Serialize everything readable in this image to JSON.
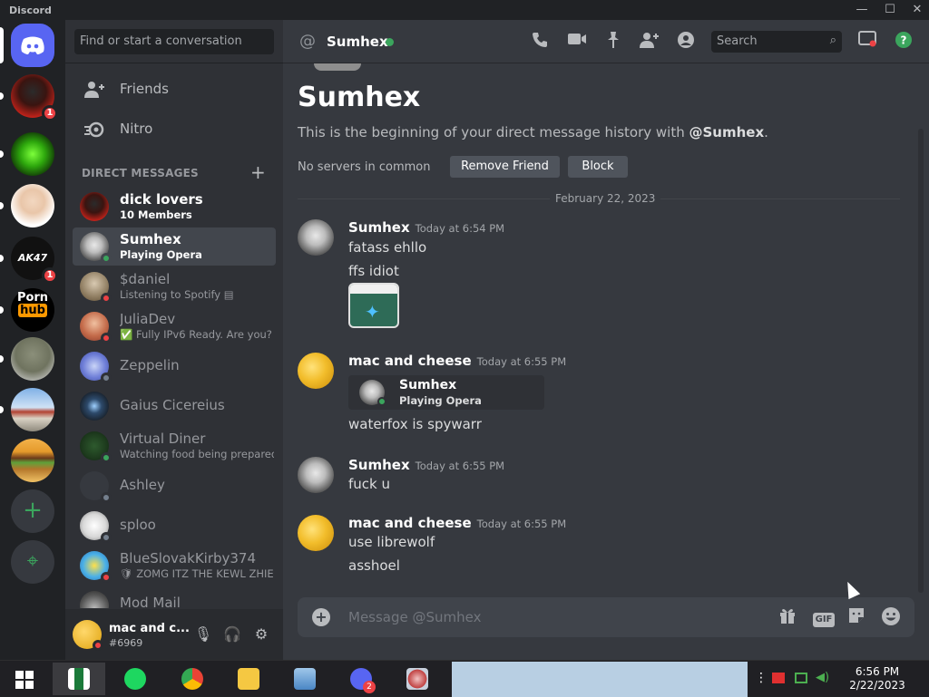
{
  "app": {
    "title": "Discord"
  },
  "window_controls": {
    "minimize": "—",
    "maximize": "☐",
    "close": "✕"
  },
  "servers": [
    {
      "name": "Home",
      "icon": "discord-logo-icon"
    },
    {
      "name": "server-2",
      "badge": "1"
    },
    {
      "name": "server-3"
    },
    {
      "name": "server-4"
    },
    {
      "name": "server-5",
      "badge": "1"
    },
    {
      "name": "server-6",
      "text": "Porn hub"
    },
    {
      "name": "server-7"
    },
    {
      "name": "server-8"
    },
    {
      "name": "server-9"
    }
  ],
  "add_server": "+",
  "explore": "⌖",
  "dm_sidebar": {
    "search_placeholder": "Find or start a conversation",
    "nav": [
      {
        "label": "Friends",
        "icon": "friends-icon"
      },
      {
        "label": "Nitro",
        "icon": "nitro-icon"
      }
    ],
    "header": "DIRECT MESSAGES",
    "add": "+",
    "dms": [
      {
        "name": "dick lovers",
        "sub": "10 Members",
        "status": "none",
        "highlight": true
      },
      {
        "name": "Sumhex",
        "sub": "Playing Opera",
        "status": "online",
        "selected": true
      },
      {
        "name": "$daniel",
        "sub": "Listening to Spotify ▤",
        "status": "dnd"
      },
      {
        "name": "JuliaDev",
        "sub": "✅ Fully IPv6 Ready. Are you?",
        "status": "dnd"
      },
      {
        "name": "Zeppelin",
        "sub": "",
        "status": "offline"
      },
      {
        "name": "Gaius Cicereius",
        "sub": "",
        "status": "offline"
      },
      {
        "name": "Virtual Diner",
        "sub": "Watching food being prepared!",
        "status": "online"
      },
      {
        "name": "Ashley",
        "sub": "",
        "status": "offline"
      },
      {
        "name": "sploo",
        "sub": "",
        "status": "offline"
      },
      {
        "name": "BlueSlovakKirby374",
        "sub": "🛡 ZOMG ITZ THE KEWL ZHIE...",
        "status": "dnd"
      },
      {
        "name": "Mod Mail",
        "sub": "",
        "status": "offline"
      }
    ]
  },
  "user_panel": {
    "username": "mac and c...",
    "tag": "#6969",
    "mic": "🎙",
    "headset": "🎧",
    "settings": "⚙"
  },
  "chat": {
    "header": {
      "at": "@",
      "name": "Sumhex",
      "search": "Search",
      "search_icon": "⌕"
    },
    "intro": {
      "name": "Sumhex",
      "text_prefix": "This is the beginning of your direct message history with ",
      "text_user": "@Sumhex",
      "text_suffix": ".",
      "no_servers": "No servers in common",
      "remove_friend": "Remove Friend",
      "block": "Block"
    },
    "date_divider": "February 22, 2023",
    "messages": [
      {
        "author": "Sumhex",
        "time": "Today at 6:54 PM",
        "lines": [
          "fatass ehllo",
          "ffs idiot"
        ]
      },
      {
        "author": "mac and cheese",
        "time": "Today at 6:55 PM",
        "embed": {
          "name": "Sumhex",
          "sub": "Playing Opera"
        },
        "lines": [
          "waterfox is spywarr"
        ]
      },
      {
        "author": "Sumhex",
        "time": "Today at 6:55 PM",
        "lines": [
          "fuck u"
        ]
      },
      {
        "author": "mac and cheese",
        "time": "Today at 6:55 PM",
        "lines": [
          "use librewolf",
          "asshoel"
        ]
      }
    ],
    "composer": {
      "placeholder": "Message @Sumhex",
      "gif": "GIF"
    }
  },
  "taskbar": {
    "time": "6:56 PM",
    "date": "2/22/2023",
    "discord_badge": "2"
  },
  "colors": {
    "accent": "#5865f2",
    "online": "#3ba55d",
    "dnd": "#ed4245",
    "offline": "#747f8d"
  }
}
